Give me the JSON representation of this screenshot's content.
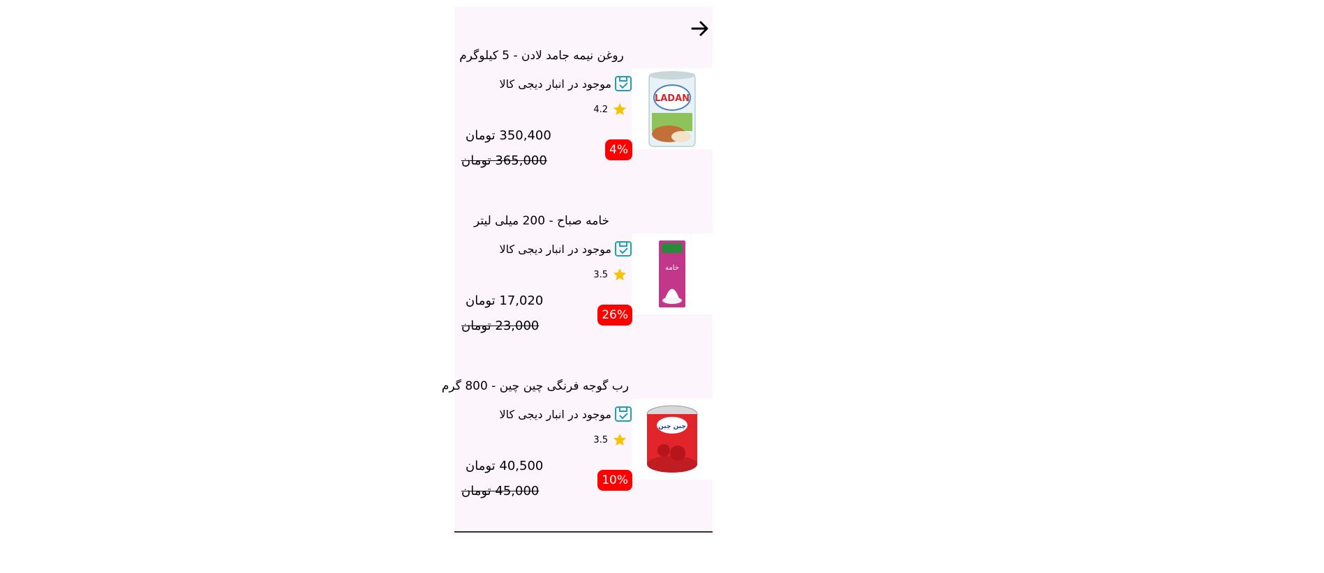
{
  "header": {
    "back_icon": "arrow-right-icon"
  },
  "colors": {
    "panel_bg": "#fcf5fc",
    "badge": "#ff0000",
    "stock_icon": "#1aa0b8",
    "star": "#f5c400"
  },
  "products": [
    {
      "title": "روغن نیمه جامد لادن - 5 کیلوگرم",
      "stock": "موجود در انبار دیجی کالا",
      "rating": "4.2",
      "price": "350,400 تومان",
      "old_price": "365,000 تومان",
      "discount": "4%",
      "image_label": "LADAN"
    },
    {
      "title": "خامه صباح - 200 میلی لیتر",
      "stock": "موجود در انبار دیجی کالا",
      "rating": "3.5",
      "price": "17,020 تومان",
      "old_price": "23,000 تومان",
      "discount": "26%",
      "image_label": "خامه"
    },
    {
      "title": "رب گوجه فرنگی چین چین - 800 گرم",
      "stock": "موجود در انبار دیجی کالا",
      "rating": "3.5",
      "price": "40,500 تومان",
      "old_price": "45,000 تومان",
      "discount": "10%",
      "image_label": "چین چین"
    }
  ]
}
